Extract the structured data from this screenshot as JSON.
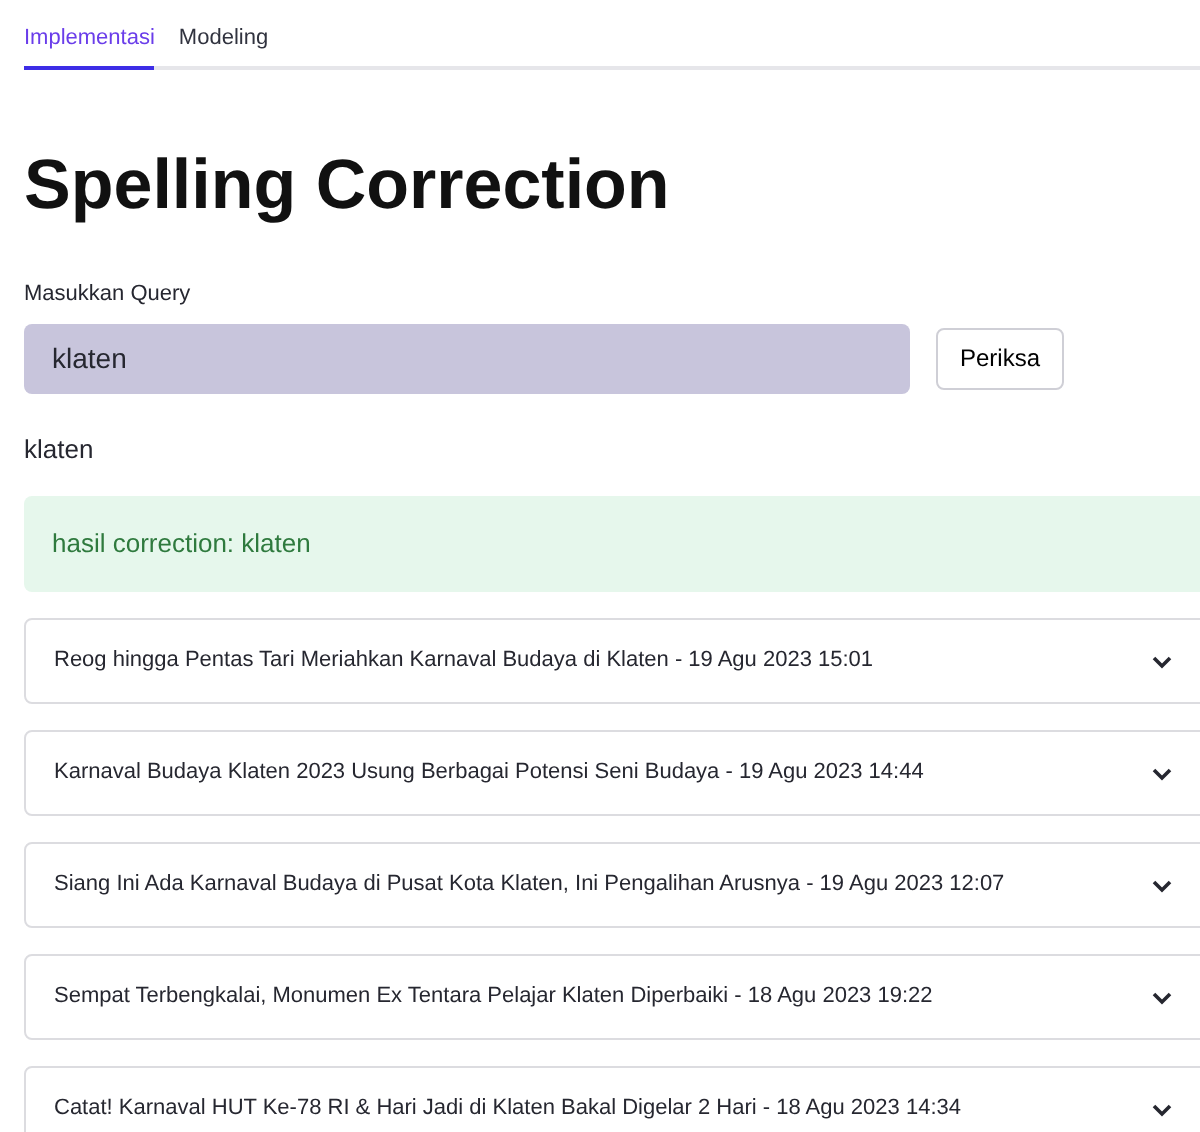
{
  "tabs": [
    {
      "label": "Implementasi",
      "selected": true
    },
    {
      "label": "Modeling",
      "selected": false
    }
  ],
  "title": "Spelling Correction",
  "query": {
    "label": "Masukkan Query",
    "value": "klaten"
  },
  "button": "Periksa",
  "echo": "klaten",
  "alert": "hasil correction: klaten",
  "results": [
    {
      "title": "Reog hingga Pentas Tari Meriahkan Karnaval Budaya di Klaten - 19 Agu 2023 15:01",
      "expanded": false
    },
    {
      "title": "Karnaval Budaya Klaten 2023 Usung Berbagai Potensi Seni Budaya - 19 Agu 2023 14:44",
      "expanded": false
    },
    {
      "title": "Siang Ini Ada Karnaval Budaya di Pusat Kota Klaten, Ini Pengalihan Arusnya - 19 Agu 2023 12:07",
      "expanded": false
    },
    {
      "title": "Sempat Terbengkalai, Monumen Ex Tentara Pelajar Klaten Diperbaiki - 18 Agu 2023 19:22",
      "expanded": false
    },
    {
      "title": "Catat! Karnaval HUT Ke-78 RI & Hari Jadi di Klaten Bakal Digelar 2 Hari - 18 Agu 2023 14:34",
      "expanded": false
    }
  ]
}
